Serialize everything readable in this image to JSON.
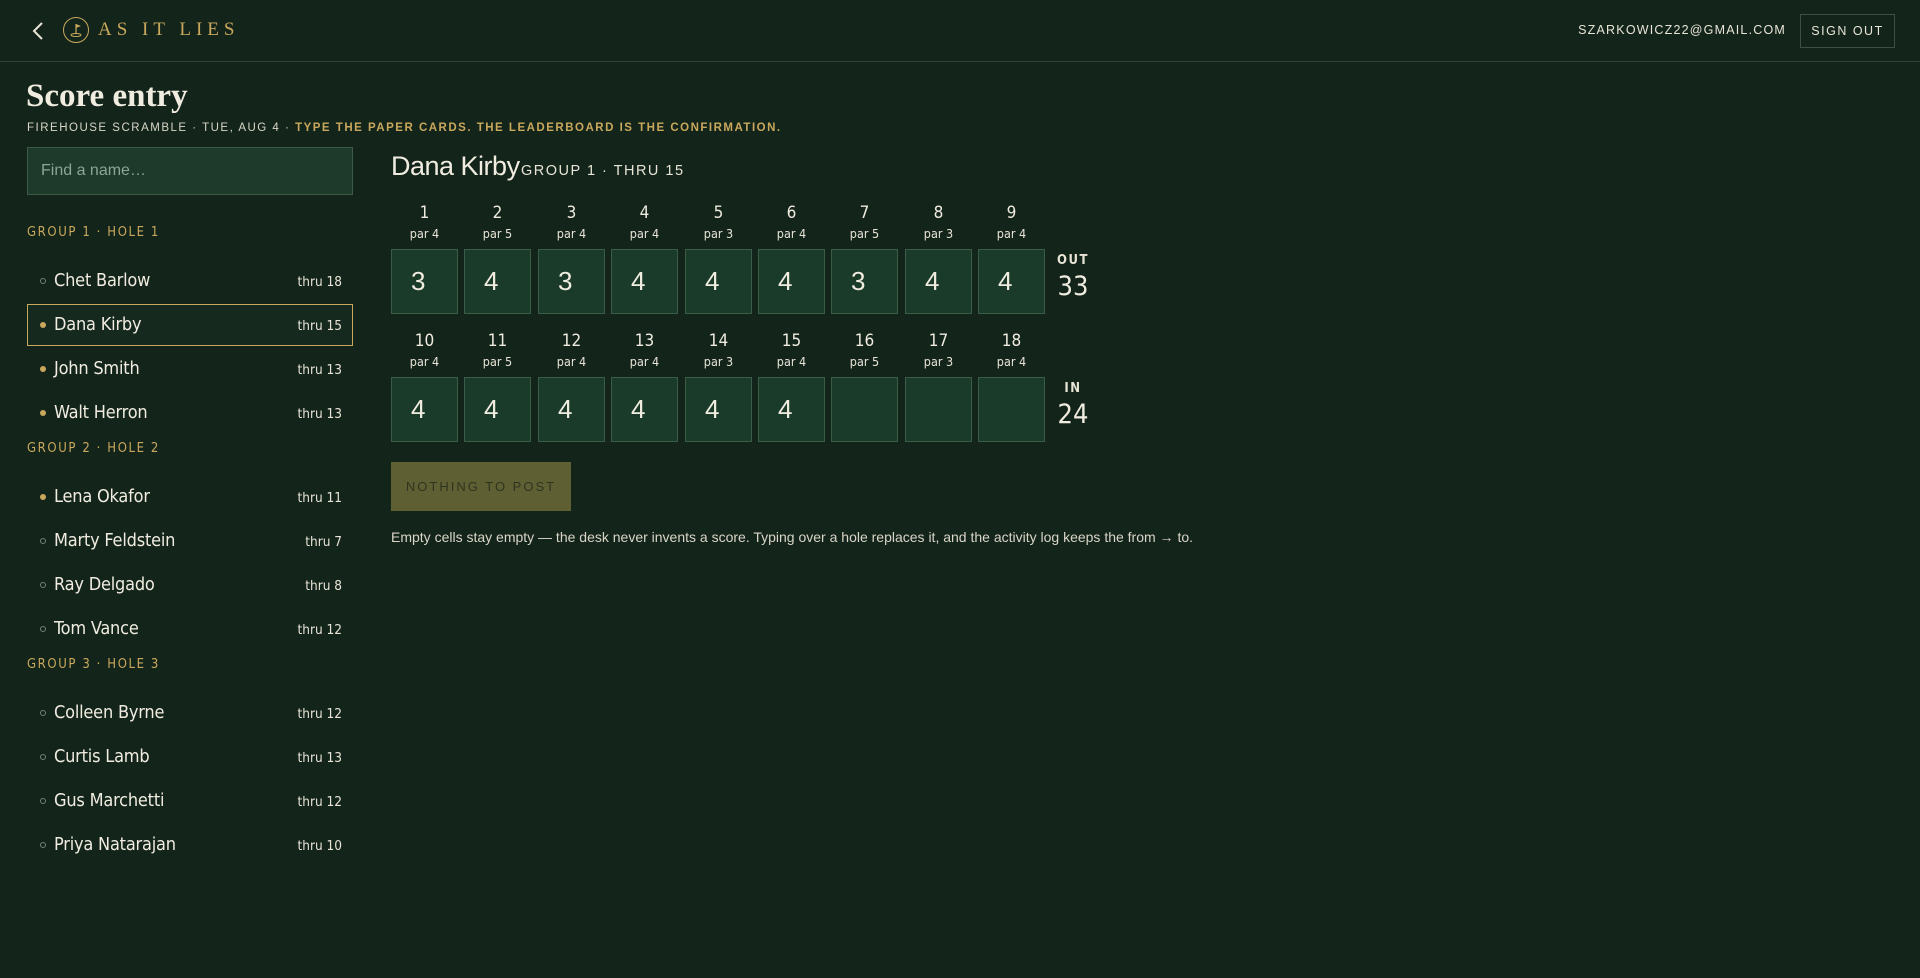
{
  "header": {
    "brand": "AS IT LIES",
    "user_email": "SZARKOWICZ22@GMAIL.COM",
    "signout_label": "SIGN OUT"
  },
  "page": {
    "title": "Score entry",
    "subtitle_prefix": "FIREHOUSE SCRAMBLE · TUE, AUG 4 · ",
    "subtitle_highlight": "TYPE THE PAPER CARDS. THE LEADERBOARD IS THE CONFIRMATION."
  },
  "search": {
    "placeholder": "Find a name…",
    "value": ""
  },
  "groups": [
    {
      "label": "GROUP 1 · HOLE 1",
      "players": [
        {
          "name": "Chet Barlow",
          "thru": "thru 18",
          "dot": "empty",
          "active": false
        },
        {
          "name": "Dana Kirby",
          "thru": "thru 15",
          "dot": "filled",
          "active": true
        },
        {
          "name": "John Smith",
          "thru": "thru 13",
          "dot": "filled",
          "active": false
        },
        {
          "name": "Walt Herron",
          "thru": "thru 13",
          "dot": "filled",
          "active": false
        }
      ]
    },
    {
      "label": "GROUP 2 · HOLE 2",
      "players": [
        {
          "name": "Lena Okafor",
          "thru": "thru 11",
          "dot": "filled",
          "active": false
        },
        {
          "name": "Marty Feldstein",
          "thru": "thru 7",
          "dot": "empty",
          "active": false
        },
        {
          "name": "Ray Delgado",
          "thru": "thru 8",
          "dot": "empty",
          "active": false
        },
        {
          "name": "Tom Vance",
          "thru": "thru 12",
          "dot": "empty",
          "active": false
        }
      ]
    },
    {
      "label": "GROUP 3 · HOLE 3",
      "players": [
        {
          "name": "Colleen Byrne",
          "thru": "thru 12",
          "dot": "empty",
          "active": false
        },
        {
          "name": "Curtis Lamb",
          "thru": "thru 13",
          "dot": "empty",
          "active": false
        },
        {
          "name": "Gus Marchetti",
          "thru": "thru 12",
          "dot": "empty",
          "active": false
        },
        {
          "name": "Priya Natarajan",
          "thru": "thru 10",
          "dot": "empty",
          "active": false
        }
      ]
    }
  ],
  "card": {
    "player_name": "Dana Kirby",
    "meta": "GROUP 1 · THRU 15",
    "front": {
      "holes": [
        {
          "num": "1",
          "par": "par 4",
          "score": "3"
        },
        {
          "num": "2",
          "par": "par 5",
          "score": "4"
        },
        {
          "num": "3",
          "par": "par 4",
          "score": "3"
        },
        {
          "num": "4",
          "par": "par 4",
          "score": "4"
        },
        {
          "num": "5",
          "par": "par 3",
          "score": "4"
        },
        {
          "num": "6",
          "par": "par 4",
          "score": "4"
        },
        {
          "num": "7",
          "par": "par 5",
          "score": "3"
        },
        {
          "num": "8",
          "par": "par 3",
          "score": "4"
        },
        {
          "num": "9",
          "par": "par 4",
          "score": "4"
        }
      ],
      "total_label": "OUT",
      "total": "33"
    },
    "back": {
      "holes": [
        {
          "num": "10",
          "par": "par 4",
          "score": "4"
        },
        {
          "num": "11",
          "par": "par 5",
          "score": "4"
        },
        {
          "num": "12",
          "par": "par 4",
          "score": "4"
        },
        {
          "num": "13",
          "par": "par 4",
          "score": "4"
        },
        {
          "num": "14",
          "par": "par 3",
          "score": "4"
        },
        {
          "num": "15",
          "par": "par 4",
          "score": "4"
        },
        {
          "num": "16",
          "par": "par 5",
          "score": ""
        },
        {
          "num": "17",
          "par": "par 3",
          "score": ""
        },
        {
          "num": "18",
          "par": "par 4",
          "score": ""
        }
      ],
      "total_label": "IN",
      "total": "24"
    },
    "post_label": "NOTHING TO POST",
    "note": "Empty cells stay empty — the desk never invents a score. Typing over a hole replaces it, and the activity log keeps the from → to."
  },
  "colors": {
    "background": "#13241b",
    "accent": "#c9a85c",
    "cell": "#1b3b2a",
    "post_button": "#5e6034"
  }
}
